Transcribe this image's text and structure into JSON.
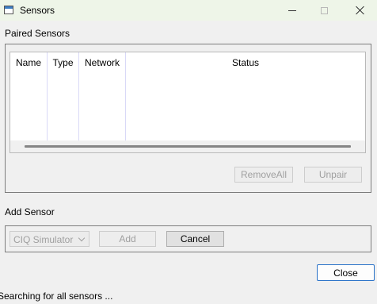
{
  "window": {
    "title": "Sensors"
  },
  "paired": {
    "section_label": "Paired Sensors",
    "columns": [
      "Name",
      "Type",
      "Network",
      "Status"
    ],
    "rows": [],
    "remove_all_label": "RemoveAll",
    "unpair_label": "Unpair"
  },
  "add": {
    "section_label": "Add Sensor",
    "sensor_select_value": "CIQ Simulator",
    "add_label": "Add",
    "cancel_label": "Cancel"
  },
  "footer": {
    "close_label": "Close"
  },
  "status": {
    "text": "Searching for all sensors ..."
  }
}
